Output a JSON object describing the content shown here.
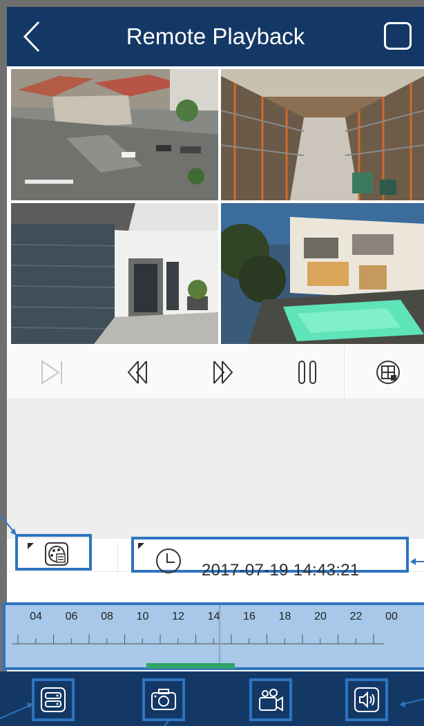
{
  "header": {
    "title": "Remote Playback"
  },
  "cameras": [
    {
      "name": "street-camera"
    },
    {
      "name": "warehouse-camera"
    },
    {
      "name": "garage-camera"
    },
    {
      "name": "pool-camera"
    }
  ],
  "controls": {
    "icons": [
      "play-next-icon",
      "rewind-icon",
      "fast-forward-icon",
      "pause-icon",
      "grid-layout-icon"
    ]
  },
  "info": {
    "datetime": "2017-07-19 14:43:21"
  },
  "timeline": {
    "hours": [
      "04",
      "06",
      "08",
      "10",
      "12",
      "14",
      "16",
      "18",
      "20",
      "22",
      "00"
    ],
    "recording_bar_color": "#2fa569"
  },
  "bottom_bar": {
    "icons": [
      "record-list-icon",
      "snapshot-camera-icon",
      "video-record-icon",
      "speaker-icon"
    ]
  },
  "colors": {
    "header": "#143866",
    "highlight": "#2e74bf",
    "timeline_bg": "#a7c8e8"
  }
}
